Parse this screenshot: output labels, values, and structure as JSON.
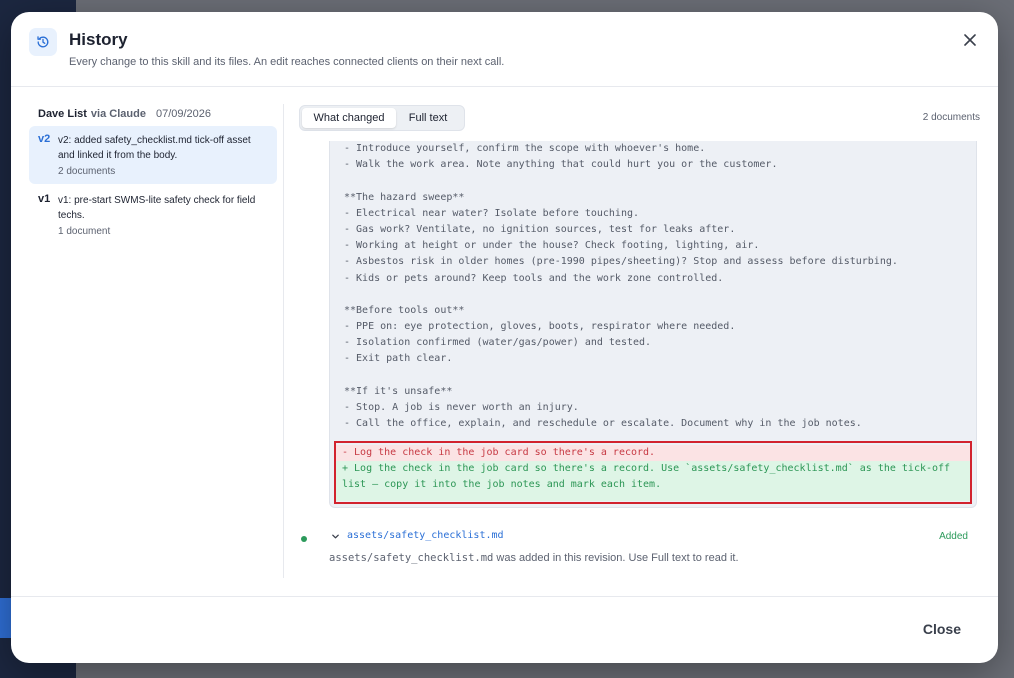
{
  "modal": {
    "title": "History",
    "subtitle": "Every change to this skill and its files. An edit reaches connected clients on their next call."
  },
  "revisions": {
    "author": "Dave List",
    "via": "via Claude",
    "date": "07/09/2026",
    "items": [
      {
        "version": "v2",
        "description": "v2: added safety_checklist.md tick-off asset and linked it from the body.",
        "docs": "2 documents",
        "active": true
      },
      {
        "version": "v1",
        "description": "v1: pre-start SWMS-lite safety check for field techs.",
        "docs": "1 document",
        "active": false
      }
    ]
  },
  "tabs": {
    "what_changed": "What changed",
    "full_text": "Full text",
    "selected": "What changed"
  },
  "doc_count": "2 documents",
  "diff": {
    "context_lines": [
      "- Introduce yourself, confirm the scope with whoever's home.",
      "- Walk the work area. Note anything that could hurt you or the customer.",
      "",
      "**The hazard sweep**",
      "- Electrical near water? Isolate before touching.",
      "- Gas work? Ventilate, no ignition sources, test for leaks after.",
      "- Working at height or under the house? Check footing, lighting, air.",
      "- Asbestos risk in older homes (pre-1990 pipes/sheeting)? Stop and assess before disturbing.",
      "- Kids or pets around? Keep tools and the work zone controlled.",
      "",
      "**Before tools out**",
      "- PPE on: eye protection, gloves, boots, respirator where needed.",
      "- Isolation confirmed (water/gas/power) and tested.",
      "- Exit path clear.",
      "",
      "**If it's unsafe**",
      "- Stop. A job is never worth an injury.",
      "- Call the office, explain, and reschedule or escalate. Document why in the job notes."
    ],
    "removed": "- Log the check in the job card so there's a record.",
    "added": "+ Log the check in the job card so there's a record. Use `assets/safety_checklist.md` as the tick-off list — copy it into the job notes and mark each item."
  },
  "file": {
    "path": "assets/safety_checklist.md",
    "status": "Added",
    "note_path": "assets/safety_checklist.md",
    "note_text": " was added in this revision. Use Full text to read it."
  },
  "footer": {
    "close_label": "Close"
  },
  "colors": {
    "accent": "#2a6fd6",
    "added": "#2c9a5b",
    "removed": "#c73a44",
    "highlight_border": "#d2222e"
  }
}
